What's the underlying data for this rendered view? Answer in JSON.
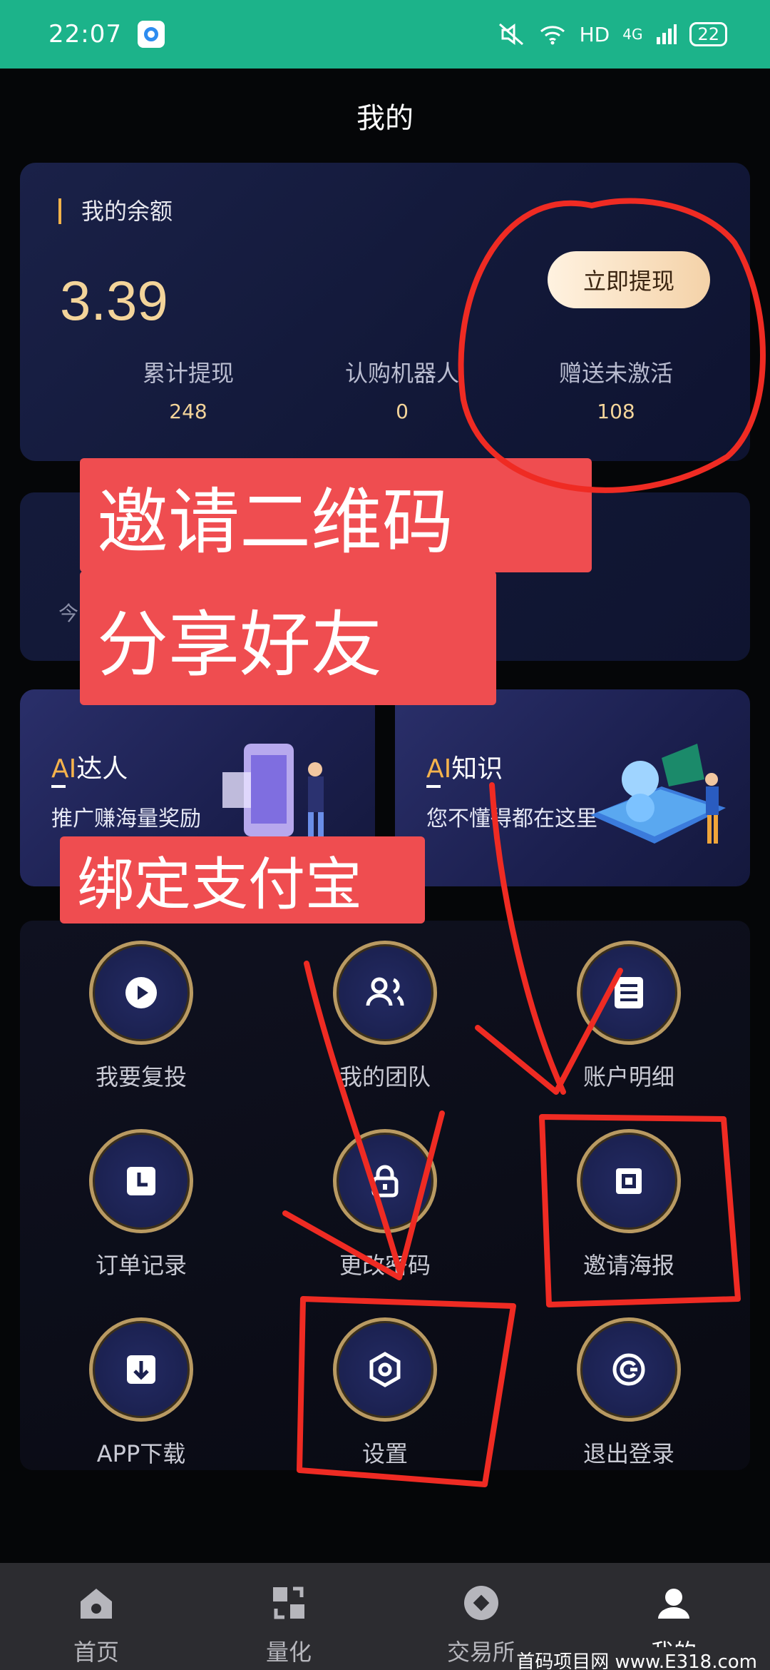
{
  "status_bar": {
    "time": "22:07",
    "network": "HD",
    "signal": "4G",
    "battery": "22"
  },
  "header": {
    "title": "我的"
  },
  "balance": {
    "title": "我的余额",
    "amount": "3.39",
    "withdraw_label": "立即提现",
    "stats": [
      {
        "label": "累计提现",
        "value": "248"
      },
      {
        "label": "认购机器人",
        "value": "0"
      },
      {
        "label": "赠送未激活",
        "value": "108"
      }
    ]
  },
  "team": {
    "text": "今日团队"
  },
  "promos": [
    {
      "ai": "AI",
      "title": "达人",
      "subtitle": "推广赚海量奖励"
    },
    {
      "ai": "AI",
      "title": "知识",
      "subtitle": "您不懂得都在这里"
    }
  ],
  "menu": [
    {
      "label": "我要复投",
      "icon": "play-icon"
    },
    {
      "label": "我的团队",
      "icon": "team-icon"
    },
    {
      "label": "账户明细",
      "icon": "list-icon"
    },
    {
      "label": "订单记录",
      "icon": "clock-icon"
    },
    {
      "label": "更改密码",
      "icon": "lock-icon"
    },
    {
      "label": "邀请海报",
      "icon": "qr-icon"
    },
    {
      "label": "APP下载",
      "icon": "download-icon"
    },
    {
      "label": "设置",
      "icon": "settings-icon"
    },
    {
      "label": "退出登录",
      "icon": "logout-icon"
    }
  ],
  "overlays": {
    "invite_line1": "邀请二维码",
    "invite_line2": "分享好友",
    "bind_alipay": "绑定支付宝"
  },
  "nav": [
    {
      "label": "首页",
      "icon": "home-icon"
    },
    {
      "label": "量化",
      "icon": "quant-icon"
    },
    {
      "label": "交易所",
      "icon": "exchange-icon"
    },
    {
      "label": "我的",
      "icon": "profile-icon"
    }
  ],
  "watermark": "首码项目网 www.E318.com",
  "colors": {
    "status_bar": "#1cb38a",
    "gold": "#f3d49a",
    "annotation_red": "#ef2b23",
    "overlay_red": "#ef4d50"
  }
}
